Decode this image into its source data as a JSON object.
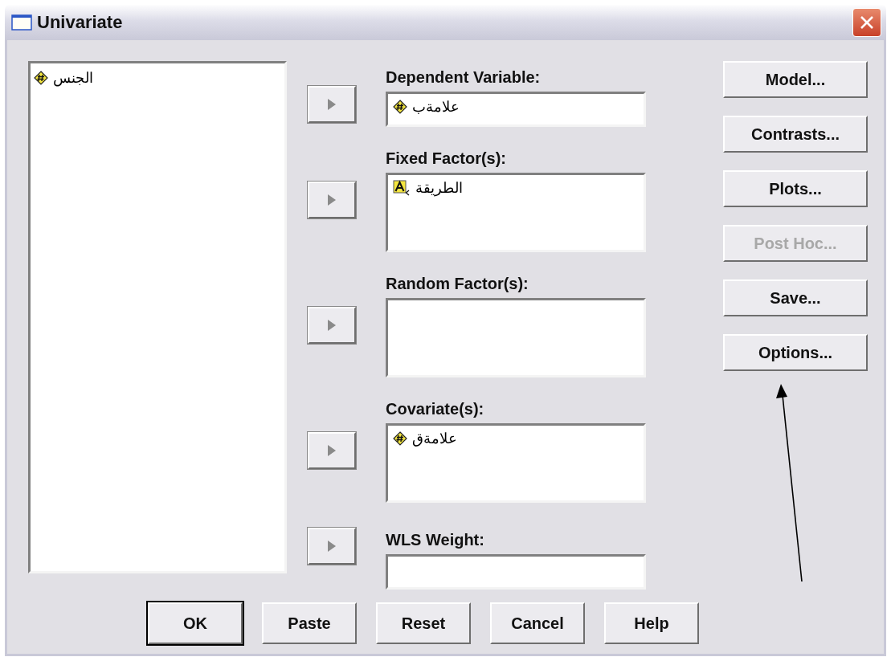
{
  "window": {
    "title": "Univariate"
  },
  "source_list": {
    "items": [
      {
        "name": "الجنس",
        "kind": "scale"
      }
    ]
  },
  "fields": [
    {
      "label": "Dependent Variable:",
      "kind": "single",
      "items": [
        {
          "name": "علامةب",
          "kind": "scale"
        }
      ]
    },
    {
      "label": "Fixed Factor(s):",
      "kind": "list",
      "items": [
        {
          "name": "الطريقة",
          "kind": "nominal"
        }
      ]
    },
    {
      "label": "Random Factor(s):",
      "kind": "list"
    },
    {
      "label": "Covariate(s):",
      "kind": "list",
      "items": [
        {
          "name": "علامةق",
          "kind": "scale"
        }
      ]
    },
    {
      "label": "WLS Weight:",
      "kind": "single"
    }
  ],
  "side_buttons": [
    {
      "label": "Model...",
      "disabled": false
    },
    {
      "label": "Contrasts...",
      "disabled": false
    },
    {
      "label": "Plots...",
      "disabled": false
    },
    {
      "label": "Post Hoc...",
      "disabled": true
    },
    {
      "label": "Save...",
      "disabled": false
    },
    {
      "label": "Options...",
      "disabled": false
    }
  ],
  "bottom_buttons": [
    {
      "label": "OK",
      "default": true
    },
    {
      "label": "Paste",
      "default": false
    },
    {
      "label": "Reset",
      "default": false
    },
    {
      "label": "Cancel",
      "default": false
    },
    {
      "label": "Help",
      "default": false
    }
  ]
}
